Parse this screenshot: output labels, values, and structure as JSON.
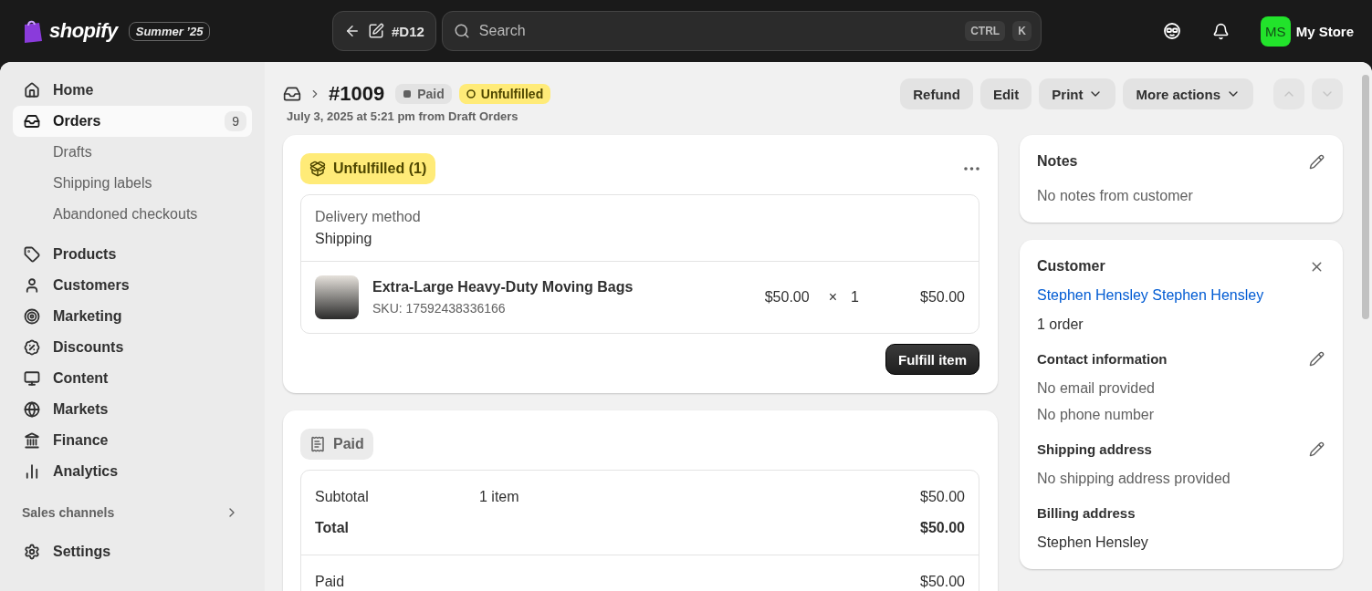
{
  "topbar": {
    "logo": "shopify",
    "edition": "Summer ’25",
    "back_label": "#D12",
    "search": {
      "placeholder": "Search"
    },
    "shortcut": [
      "CTRL",
      "K"
    ],
    "avatar": "MS",
    "store": "My Store"
  },
  "sidebar": {
    "items": [
      {
        "label": "Home",
        "selected": false
      },
      {
        "label": "Orders",
        "selected": true,
        "badge": "9",
        "children": [
          {
            "label": "Drafts"
          },
          {
            "label": "Shipping labels"
          },
          {
            "label": "Abandoned checkouts"
          }
        ]
      },
      {
        "label": "Products",
        "selected": false
      },
      {
        "label": "Customers",
        "selected": false
      },
      {
        "label": "Marketing",
        "selected": false
      },
      {
        "label": "Discounts",
        "selected": false
      },
      {
        "label": "Content",
        "selected": false
      },
      {
        "label": "Markets",
        "selected": false
      },
      {
        "label": "Finance",
        "selected": false
      },
      {
        "label": "Analytics",
        "selected": false
      }
    ],
    "section": "Sales channels",
    "footer": "Settings"
  },
  "header": {
    "title": "#1009",
    "badges": [
      {
        "label": "Paid",
        "kind": "neutral"
      },
      {
        "label": "Unfulfilled",
        "kind": "warning"
      }
    ],
    "subtitle": "July 3, 2025 at 5:21 pm from Draft Orders",
    "actions": [
      {
        "label": "Refund",
        "kind": "plain"
      },
      {
        "label": "Edit",
        "kind": "plain"
      },
      {
        "label": "Print",
        "kind": "menu"
      },
      {
        "label": "More actions",
        "kind": "menu"
      }
    ],
    "nav": [
      {
        "kind": "up",
        "disabled": true
      },
      {
        "kind": "down",
        "disabled": true
      }
    ]
  },
  "fulfillment": {
    "badge": "Unfulfilled (1)",
    "delivery_label": "Delivery method",
    "delivery_value": "Shipping",
    "item": {
      "name": "Extra-Large Heavy-Duty Moving Bags",
      "sku": "SKU: 17592438336166",
      "price": "$50.00",
      "times": "×",
      "quantity": "1",
      "total": "$50.00"
    },
    "button": "Fulfill item"
  },
  "payment": {
    "badge": "Paid",
    "summary": [
      {
        "label": "Subtotal",
        "detail": "1 item",
        "amount": "$50.00",
        "bold": false
      },
      {
        "label": "Total",
        "amount": "$50.00",
        "bold": true
      }
    ],
    "paid": [
      {
        "label": "Paid",
        "amount": "$50.00",
        "bold": false
      }
    ]
  },
  "notes": {
    "title": "Notes",
    "text": "No notes from customer"
  },
  "customer": {
    "title": "Customer",
    "name": "Stephen Hensley Stephen Hensley",
    "orders": "1 order",
    "sections": [
      {
        "title": "Contact information",
        "editable": true,
        "lines": [
          "No email provided",
          "No phone number"
        ]
      },
      {
        "title": "Shipping address",
        "editable": true,
        "lines": [
          "No shipping address provided"
        ]
      },
      {
        "title": "Billing address",
        "editable": false,
        "lines": [
          "Stephen Hensley"
        ]
      }
    ]
  }
}
